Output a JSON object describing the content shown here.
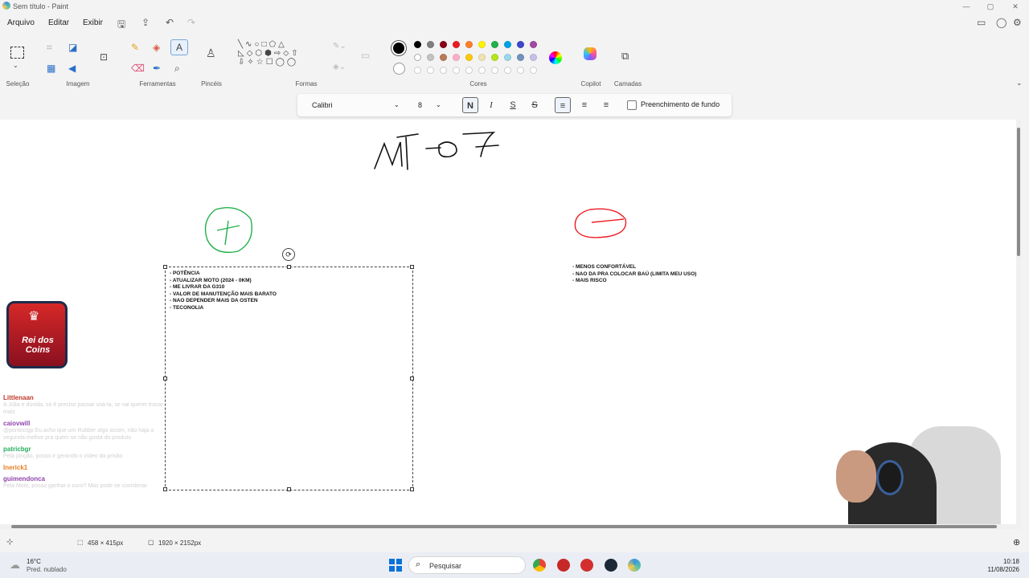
{
  "window": {
    "title": "Sem título - Paint"
  },
  "menu": {
    "file": "Arquivo",
    "edit": "Editar",
    "view": "Exibir"
  },
  "ribbon": {
    "groups": [
      "Seleção",
      "Imagem",
      "Ferramentas",
      "Pincéis",
      "Formas",
      "Cores",
      "Copilot",
      "Camadas"
    ]
  },
  "palette": {
    "row1": [
      "#000000",
      "#7f7f7f",
      "#880015",
      "#ed1c24",
      "#ff7f27",
      "#fff200",
      "#22b14c",
      "#00a2e8",
      "#3f48cc",
      "#a349a4"
    ],
    "row2": [
      "#ffffff",
      "#c3c3c3",
      "#b97a57",
      "#ffaec9",
      "#ffc90e",
      "#efe4b0",
      "#b5e61d",
      "#99d9ea",
      "#7092be",
      "#c8bfe7"
    ],
    "current": "#000000"
  },
  "text_toolbar": {
    "font": "Calibri",
    "size": "8",
    "bold": "N",
    "italic": "I",
    "underline": "S",
    "strike": "S",
    "fill_label": "Preenchimento de fundo"
  },
  "canvas": {
    "pros_lines": [
      "- POTÊNCIA",
      "- ATUALIZAR MOTO (2024 - 0KM)",
      "- ME LIVRAR DA G310",
      "- VALOR DE MANUTENÇÃO MAIS BARATO",
      "- NAO DEPENDER MAIS DA OSTEN",
      "- TECONOLIA"
    ],
    "cons_lines": [
      "- MENOS CONFORTÁVEL",
      "- NAO DA PRA COLOCAR BAÚ (LIMITA MEU USO)",
      "- MAIS RISCO"
    ]
  },
  "overlay": {
    "logo_line1": "Rei dos",
    "logo_line2": "Coins",
    "chat": [
      {
        "user": "Littlenaan",
        "color": "#c0392b",
        "msg": "A Júlia e dúvida, só é preciso passar usá-la, se vai querer trocar mais"
      },
      {
        "user": "caiovwill",
        "color": "#8e44ad",
        "msg": "@pontocigp Eu acho que um Rubber algo assim, não haja a segunda melhor pra quem se não gosta do produto"
      },
      {
        "user": "patricbgr",
        "color": "#27ae60",
        "msg": "Pela junção, posso ir gerando o vídeo da prisão"
      },
      {
        "user": "Inerick1",
        "color": "#e67e22",
        "msg": ""
      },
      {
        "user": "guimendonca",
        "color": "#8e44ad",
        "msg": "Pela Moto, posso ganhar o ouro? Mas pode se coordenar"
      }
    ]
  },
  "status": {
    "selection_size": "458 × 415px",
    "image_size": "1920 × 2152px"
  },
  "taskbar": {
    "weather_temp": "16°C",
    "weather_desc": "Pred. nublado",
    "search": "Pesquisar",
    "time": "10:18",
    "date": "11/08/2026"
  }
}
